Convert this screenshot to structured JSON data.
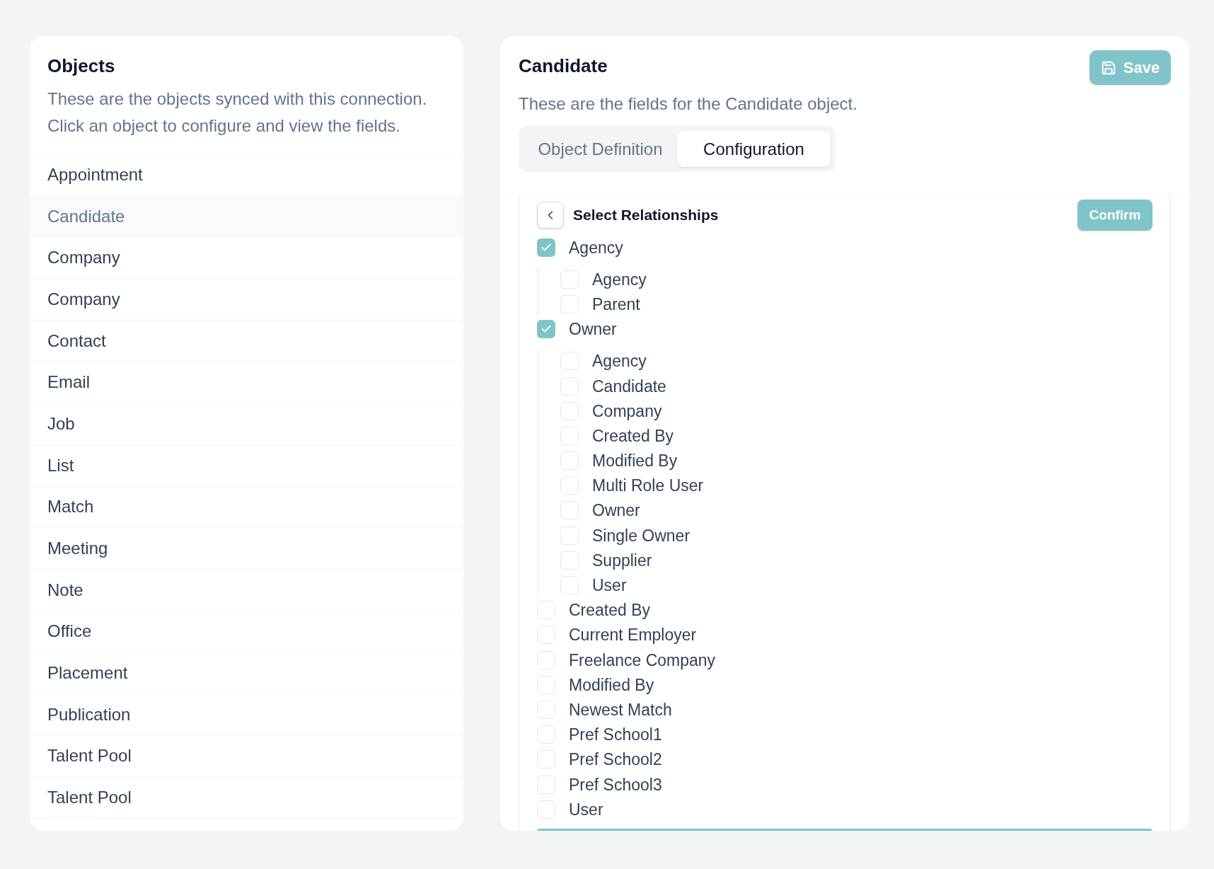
{
  "objects_panel": {
    "title": "Objects",
    "description": "These are the objects synced with this connection. Click an object to configure and view the fields.",
    "items": [
      {
        "label": "Appointment",
        "selected": false
      },
      {
        "label": "Candidate",
        "selected": true
      },
      {
        "label": "Company",
        "selected": false
      },
      {
        "label": "Company",
        "selected": false
      },
      {
        "label": "Contact",
        "selected": false
      },
      {
        "label": "Email",
        "selected": false
      },
      {
        "label": "Job",
        "selected": false
      },
      {
        "label": "List",
        "selected": false
      },
      {
        "label": "Match",
        "selected": false
      },
      {
        "label": "Meeting",
        "selected": false
      },
      {
        "label": "Note",
        "selected": false
      },
      {
        "label": "Office",
        "selected": false
      },
      {
        "label": "Placement",
        "selected": false
      },
      {
        "label": "Publication",
        "selected": false
      },
      {
        "label": "Talent Pool",
        "selected": false
      },
      {
        "label": "Talent Pool",
        "selected": false
      }
    ]
  },
  "detail_panel": {
    "title": "Candidate",
    "save_button": "Save",
    "description": "These are the fields for the Candidate object.",
    "tabs": [
      {
        "label": "Object Definition",
        "selected": false
      },
      {
        "label": "Configuration",
        "selected": true
      }
    ],
    "relationships": {
      "title": "Select Relationships",
      "confirm_button": "Confirm",
      "items": [
        {
          "label": "Agency",
          "checked": true,
          "children": [
            {
              "label": "Agency",
              "checked": false
            },
            {
              "label": "Parent",
              "checked": false
            }
          ]
        },
        {
          "label": "Owner",
          "checked": true,
          "children": [
            {
              "label": "Agency",
              "checked": false
            },
            {
              "label": "Candidate",
              "checked": false
            },
            {
              "label": "Company",
              "checked": false
            },
            {
              "label": "Created By",
              "checked": false
            },
            {
              "label": "Modified By",
              "checked": false
            },
            {
              "label": "Multi Role User",
              "checked": false
            },
            {
              "label": "Owner",
              "checked": false
            },
            {
              "label": "Single Owner",
              "checked": false
            },
            {
              "label": "Supplier",
              "checked": false
            },
            {
              "label": "User",
              "checked": false
            }
          ]
        },
        {
          "label": "Created By",
          "checked": false
        },
        {
          "label": "Current Employer",
          "checked": false
        },
        {
          "label": "Freelance Company",
          "checked": false
        },
        {
          "label": "Modified By",
          "checked": false
        },
        {
          "label": "Newest Match",
          "checked": false
        },
        {
          "label": "Pref School1",
          "checked": false
        },
        {
          "label": "Pref School2",
          "checked": false
        },
        {
          "label": "Pref School3",
          "checked": false
        },
        {
          "label": "User",
          "checked": false
        }
      ]
    }
  }
}
